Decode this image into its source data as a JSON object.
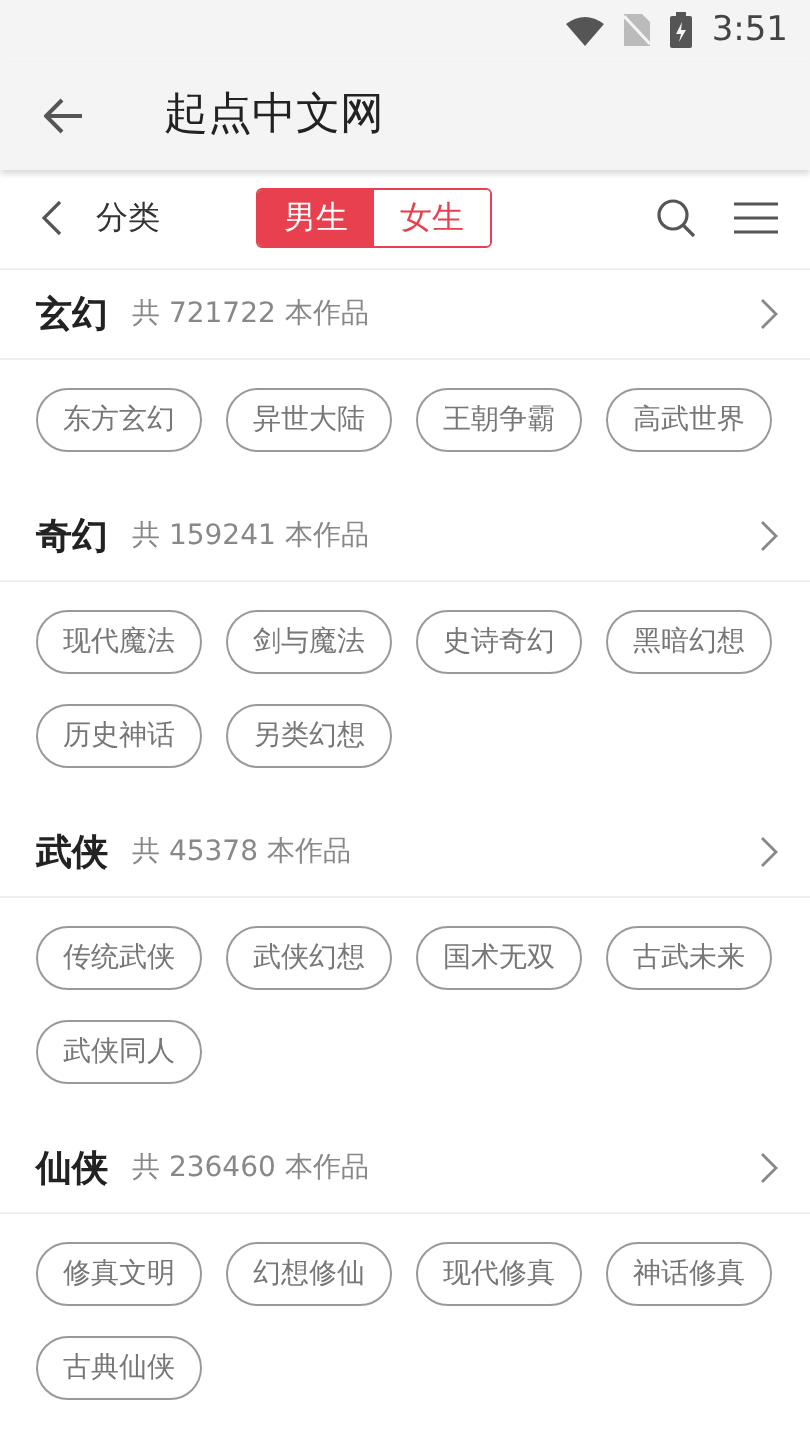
{
  "status_bar": {
    "time": "3:51"
  },
  "app_bar": {
    "title": "起点中文网"
  },
  "nav": {
    "label": "分类",
    "tabs": [
      {
        "label": "男生",
        "selected": true
      },
      {
        "label": "女生",
        "selected": false
      }
    ]
  },
  "categories": [
    {
      "name": "玄幻",
      "count": "共 721722 本作品",
      "tags": [
        "东方玄幻",
        "异世大陆",
        "王朝争霸",
        "高武世界"
      ]
    },
    {
      "name": "奇幻",
      "count": "共 159241 本作品",
      "tags": [
        "现代魔法",
        "剑与魔法",
        "史诗奇幻",
        "黑暗幻想",
        "历史神话",
        "另类幻想"
      ]
    },
    {
      "name": "武侠",
      "count": "共 45378 本作品",
      "tags": [
        "传统武侠",
        "武侠幻想",
        "国术无双",
        "古武未来",
        "武侠同人"
      ]
    },
    {
      "name": "仙侠",
      "count": "共 236460 本作品",
      "tags": [
        "修真文明",
        "幻想修仙",
        "现代修真",
        "神话修真",
        "古典仙侠"
      ]
    }
  ]
}
